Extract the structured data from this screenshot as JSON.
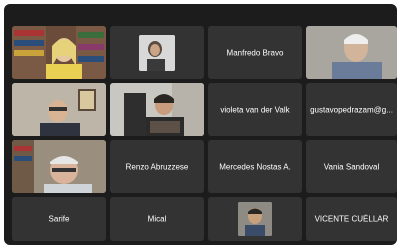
{
  "participants": [
    {
      "id": "p1",
      "name": "",
      "has_video": true,
      "speaking": false
    },
    {
      "id": "p2",
      "name": "",
      "has_video": false,
      "has_photo": true
    },
    {
      "id": "p3",
      "name": "Manfredo Bravo",
      "has_video": false
    },
    {
      "id": "p4",
      "name": "",
      "has_video": true
    },
    {
      "id": "p5",
      "name": "",
      "has_video": true,
      "speaking": true
    },
    {
      "id": "p6",
      "name": "",
      "has_video": true
    },
    {
      "id": "p7",
      "name": "violeta van der Valk",
      "has_video": false
    },
    {
      "id": "p8",
      "name": "gustavopedrazam@g...",
      "has_video": false
    },
    {
      "id": "p9",
      "name": "",
      "has_video": true
    },
    {
      "id": "p10",
      "name": "Renzo Abruzzese",
      "has_video": false
    },
    {
      "id": "p11",
      "name": "Mercedes Nostas A.",
      "has_video": false
    },
    {
      "id": "p12",
      "name": "Vania Sandoval",
      "has_video": false
    },
    {
      "id": "p13",
      "name": "Sarife",
      "has_video": false
    },
    {
      "id": "p14",
      "name": "Mical",
      "has_video": false
    },
    {
      "id": "p15",
      "name": "",
      "has_video": false,
      "has_photo": true
    },
    {
      "id": "p16",
      "name": "VICENTE CUÉLLAR",
      "has_video": false
    }
  ],
  "colors": {
    "background": "#1c1c1c",
    "tile": "#333333",
    "active_speaker": "#3ad45d",
    "name_text": "#ffffff"
  }
}
